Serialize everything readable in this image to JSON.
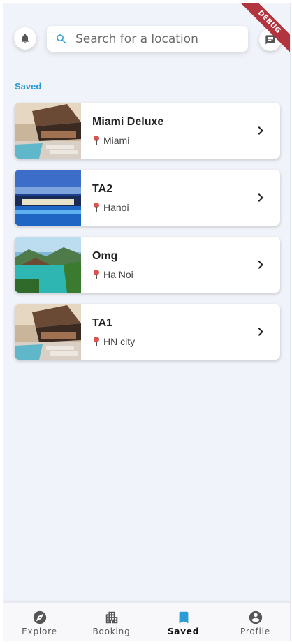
{
  "debug_banner": "DEBUG",
  "header": {
    "search_placeholder": "Search for a location",
    "icons": {
      "left": "bell-icon",
      "right": "chat-icon"
    }
  },
  "section_title": "Saved",
  "saved": [
    {
      "name": "Miami Deluxe",
      "location": "Miami"
    },
    {
      "name": "TA2",
      "location": "Hanoi"
    },
    {
      "name": "Omg",
      "location": "Ha Noi"
    },
    {
      "name": "TA1",
      "location": "HN city"
    }
  ],
  "nav": {
    "items": [
      {
        "label": "Explore",
        "icon": "compass-icon"
      },
      {
        "label": "Booking",
        "icon": "building-icon"
      },
      {
        "label": "Saved",
        "icon": "bookmark-icon",
        "active": true
      },
      {
        "label": "Profile",
        "icon": "account-icon"
      }
    ]
  },
  "colors": {
    "accent": "#2a9bd6",
    "background": "#f0f3f9",
    "pin": "#d9534f"
  }
}
